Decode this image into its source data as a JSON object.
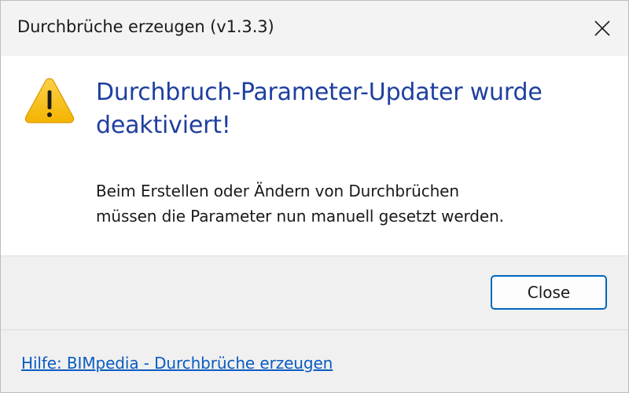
{
  "window": {
    "title": "Durchbrüche erzeugen (v1.3.3)",
    "close_icon": "close-icon"
  },
  "dialog": {
    "icon": "warning-icon",
    "main_instruction": "Durchbruch-Parameter-Updater wurde deaktiviert!",
    "content_line1": "Beim Erstellen oder Ändern von Durchbrüchen",
    "content_line2": "müssen die Parameter nun manuell gesetzt werden.",
    "colors": {
      "instruction": "#1e3f9f",
      "warning_fill": "#f9c21b",
      "accent_border": "#0067c0",
      "link": "#0a5cc2"
    }
  },
  "buttons": {
    "close_label": "Close"
  },
  "footer": {
    "help_link": "Hilfe: BIMpedia - Durchbrüche erzeugen"
  }
}
